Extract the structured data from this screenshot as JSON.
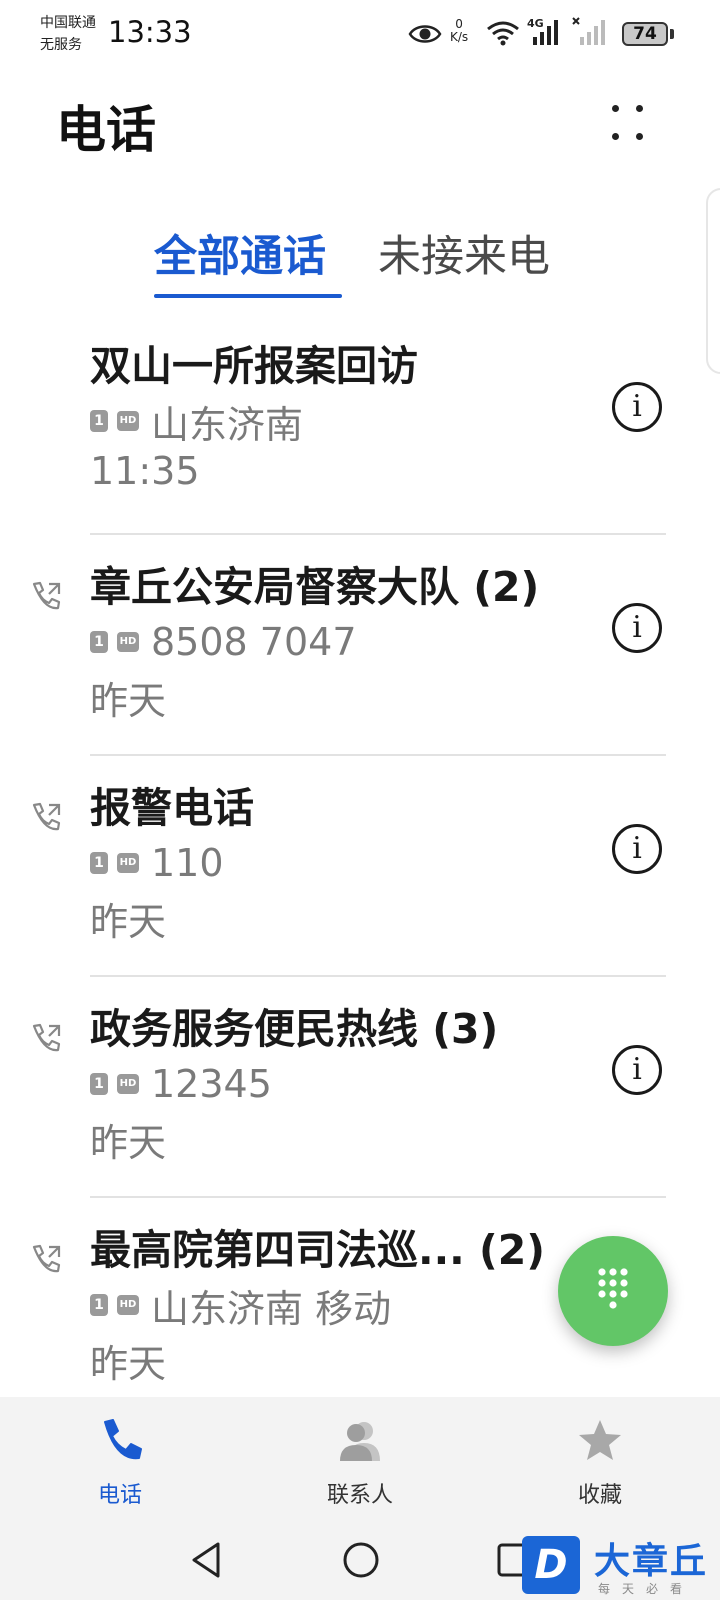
{
  "status_bar": {
    "carrier_line1": "中国联通",
    "carrier_line2": "无服务",
    "time": "13:33",
    "net_speed_value": "0",
    "net_speed_unit": "K/s",
    "network_type": "4G",
    "battery": "74",
    "icons": [
      "eye-icon",
      "wifi-icon",
      "signal-4g-icon",
      "signal-no-service-icon",
      "battery-icon"
    ]
  },
  "header": {
    "title": "电话"
  },
  "tabs": [
    {
      "label": "全部通话",
      "active": true
    },
    {
      "label": "未接来电",
      "active": false
    }
  ],
  "calls": [
    {
      "name": "双山一所报案回访",
      "sim": "1",
      "hd": "HD",
      "detail": "山东济南",
      "time": "11:35",
      "type_icon": ""
    },
    {
      "name": "章丘公安局督察大队 (2)",
      "sim": "1",
      "hd": "HD",
      "detail": "8508 7047",
      "time": "昨天",
      "type_icon": "outgoing-call-icon"
    },
    {
      "name": "报警电话",
      "sim": "1",
      "hd": "HD",
      "detail": "110",
      "time": "昨天",
      "type_icon": "outgoing-call-icon"
    },
    {
      "name": "政务服务便民热线 (3)",
      "sim": "1",
      "hd": "HD",
      "detail": "12345",
      "time": "昨天",
      "type_icon": "outgoing-call-icon"
    },
    {
      "name": "最高院第四司法巡... (2)",
      "sim": "1",
      "hd": "HD",
      "detail": "山东济南 移动",
      "time": "昨天",
      "type_icon": "outgoing-call-icon"
    }
  ],
  "info_icon": "i",
  "bottom_nav": {
    "items": [
      {
        "label": "电话",
        "icon": "phone-icon",
        "active": true
      },
      {
        "label": "联系人",
        "icon": "contacts-icon",
        "active": false
      },
      {
        "label": "收藏",
        "icon": "star-icon",
        "active": false
      }
    ]
  },
  "colors": {
    "accent": "#1a5ad0",
    "fab": "#62c667",
    "secondary_text": "#7a7a7a"
  },
  "watermark": {
    "logo_letter": "D",
    "text": "大章丘",
    "sub": "每天必看"
  }
}
